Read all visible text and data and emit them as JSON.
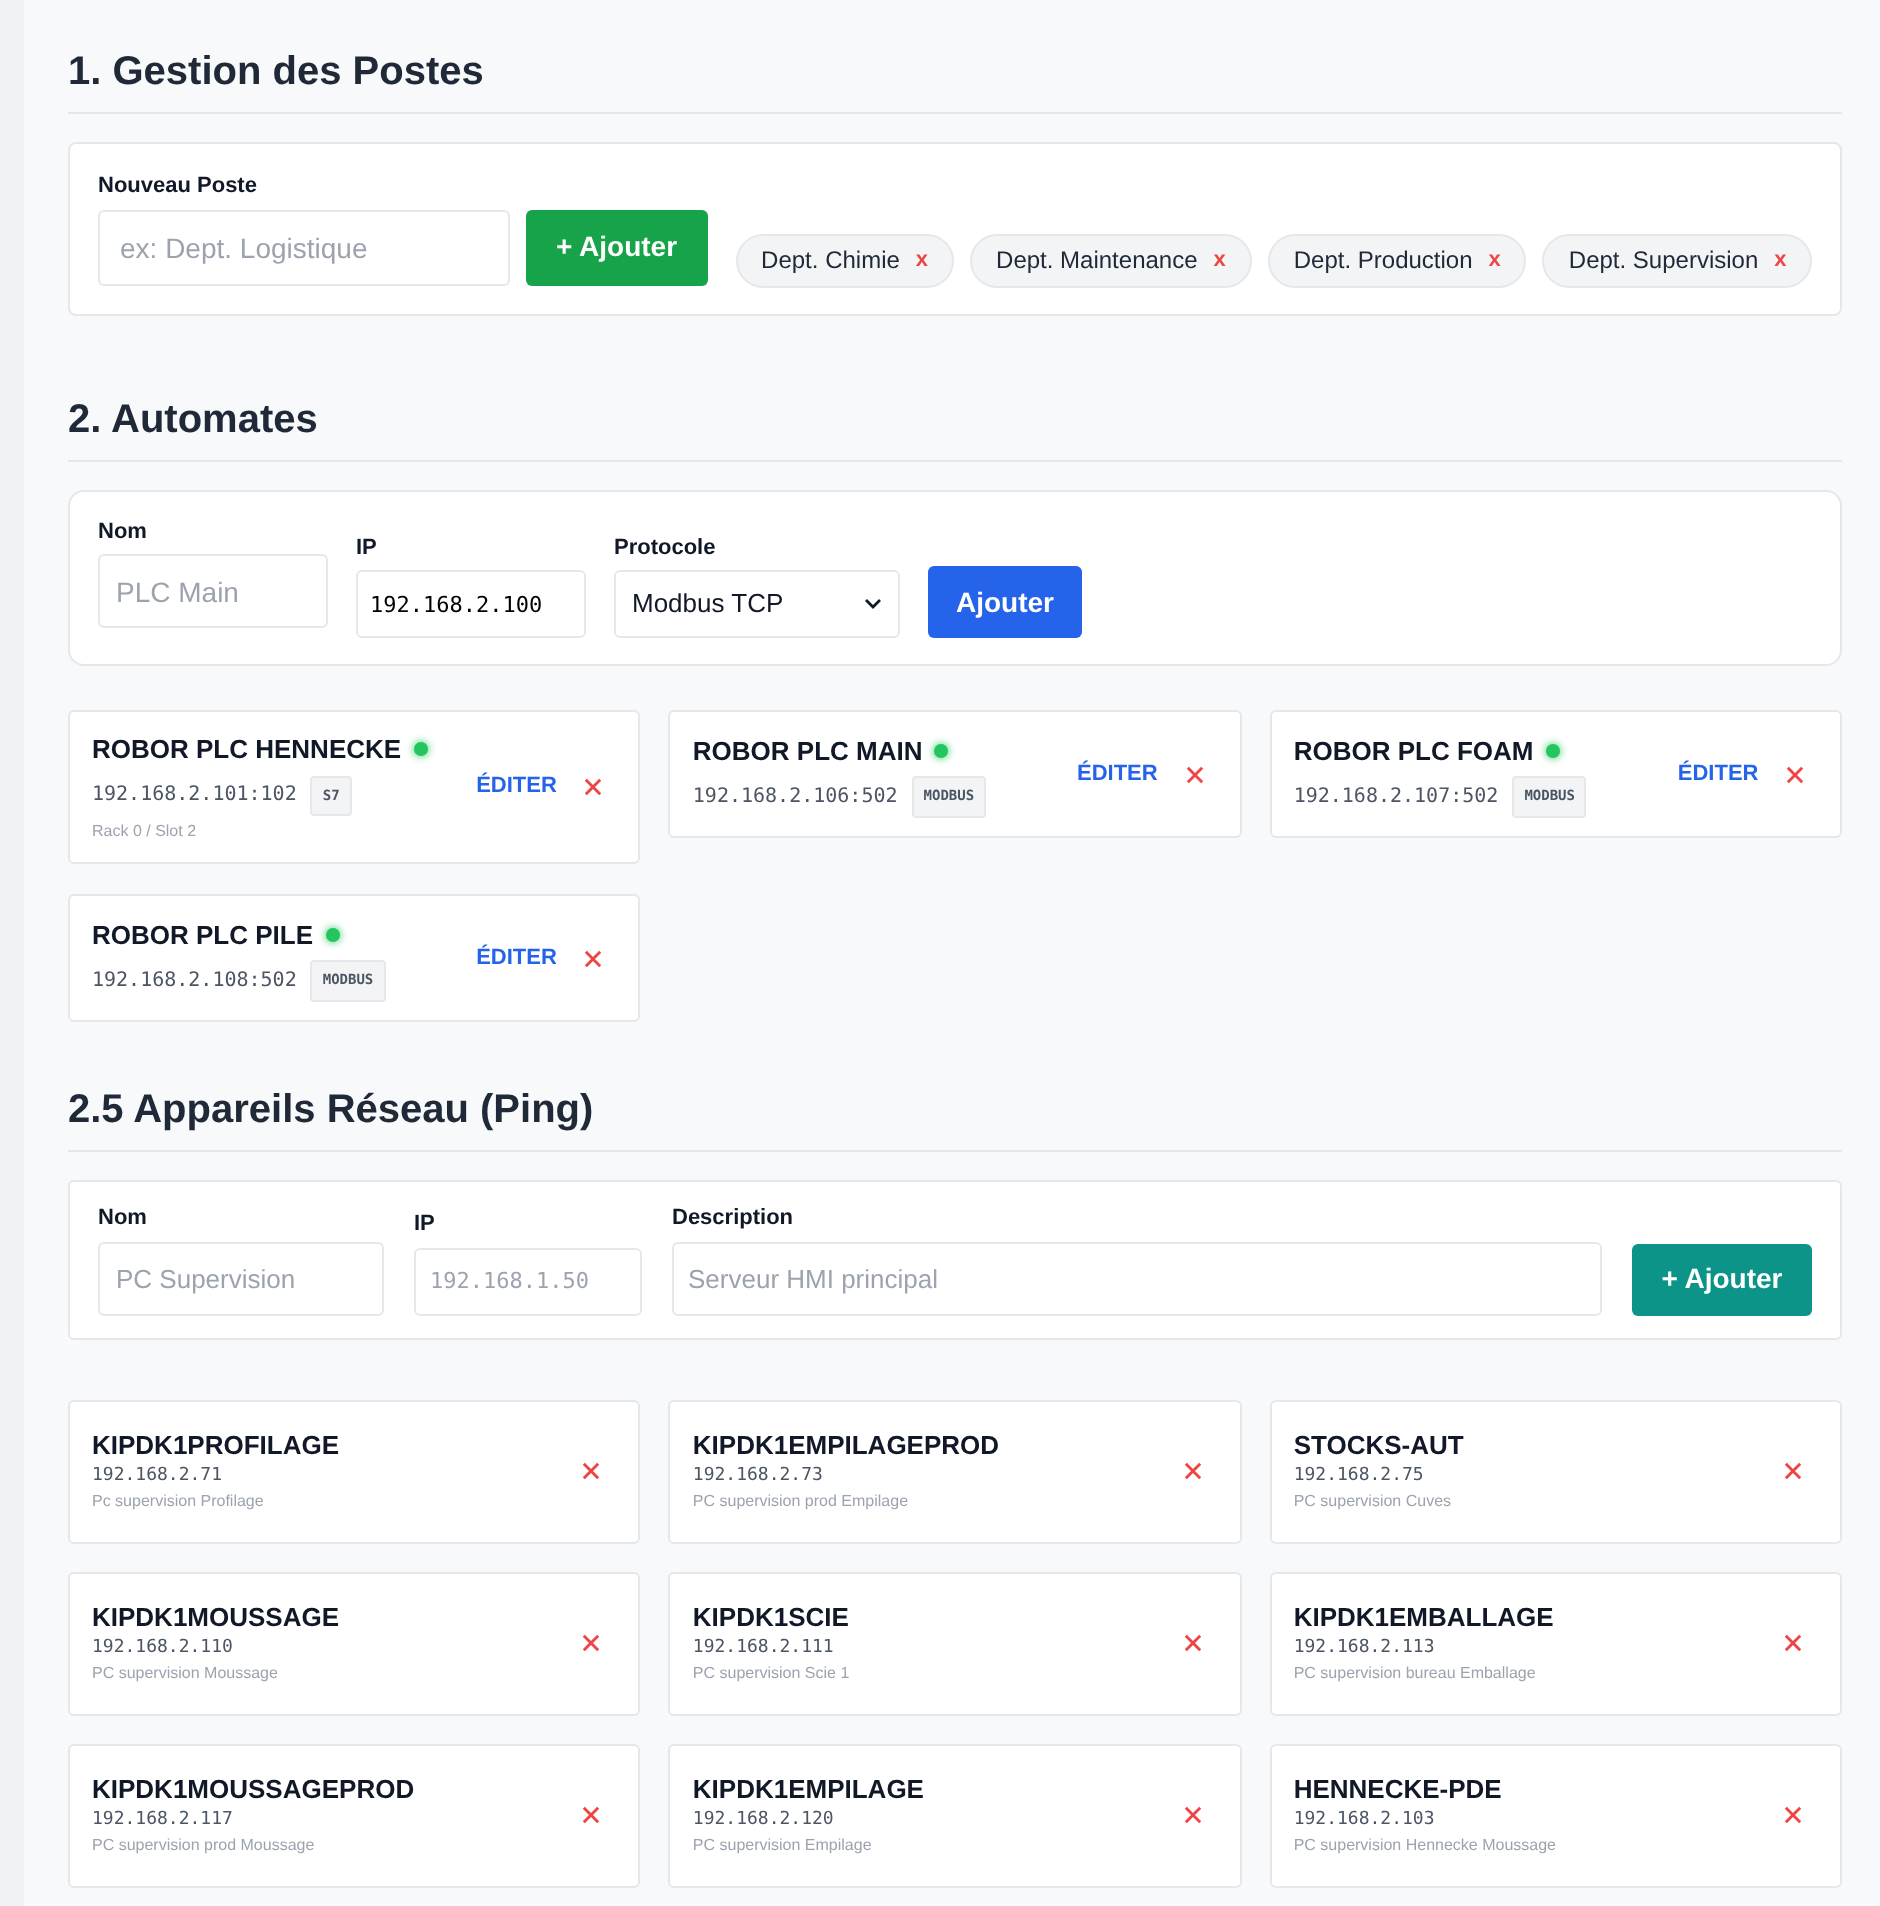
{
  "postes": {
    "title": "1. Gestion des Postes",
    "field_label": "Nouveau Poste",
    "placeholder": "ex: Dept. Logistique",
    "button": "+ Ajouter",
    "tags": [
      {
        "label": "Dept. Chimie",
        "remove": "x"
      },
      {
        "label": "Dept. Maintenance",
        "remove": "x"
      },
      {
        "label": "Dept. Production",
        "remove": "x"
      },
      {
        "label": "Dept. Supervision",
        "remove": "x"
      }
    ]
  },
  "automates": {
    "title": "2. Automates",
    "form": {
      "name_label": "Nom",
      "name_placeholder": "PLC Main",
      "ip_label": "IP",
      "ip_value": "192.168.2.100",
      "protocol_label": "Protocole",
      "protocol_value": "Modbus TCP",
      "button": "Ajouter"
    },
    "plcs": [
      {
        "name": "ROBOR PLC HENNECKE",
        "online": true,
        "address": "192.168.2.101:102",
        "protocol": "S7",
        "detail": "Rack 0 / Slot 2",
        "edit_label": "ÉDITER"
      },
      {
        "name": "ROBOR PLC MAIN",
        "online": true,
        "address": "192.168.2.106:502",
        "protocol": "MODBUS",
        "edit_label": "ÉDITER"
      },
      {
        "name": "ROBOR PLC FOAM",
        "online": true,
        "address": "192.168.2.107:502",
        "protocol": "MODBUS",
        "edit_label": "ÉDITER"
      },
      {
        "name": "ROBOR PLC PILE",
        "online": true,
        "address": "192.168.2.108:502",
        "protocol": "MODBUS",
        "edit_label": "ÉDITER"
      }
    ]
  },
  "appareils": {
    "title": "2.5 Appareils Réseau (Ping)",
    "form": {
      "name_label": "Nom",
      "name_placeholder": "PC Supervision",
      "ip_label": "IP",
      "ip_placeholder": "192.168.1.50",
      "description_label": "Description",
      "description_placeholder": "Serveur HMI principal",
      "button": "+ Ajouter"
    },
    "devices": [
      {
        "name": "KIPDK1PROFILAGE",
        "ip": "192.168.2.71",
        "description": "Pc supervision Profilage"
      },
      {
        "name": "KIPDK1EMPILAGEPROD",
        "ip": "192.168.2.73",
        "description": "PC supervision prod Empilage"
      },
      {
        "name": "STOCKS-AUT",
        "ip": "192.168.2.75",
        "description": "PC supervision Cuves"
      },
      {
        "name": "KIPDK1MOUSSAGE",
        "ip": "192.168.2.110",
        "description": "PC supervision Moussage"
      },
      {
        "name": "KIPDK1SCIE",
        "ip": "192.168.2.111",
        "description": "PC supervision Scie 1"
      },
      {
        "name": "KIPDK1EMBALLAGE",
        "ip": "192.168.2.113",
        "description": "PC supervision bureau Emballage"
      },
      {
        "name": "KIPDK1MOUSSAGEPROD",
        "ip": "192.168.2.117",
        "description": "PC supervision prod Moussage"
      },
      {
        "name": "KIPDK1EMPILAGE",
        "ip": "192.168.2.120",
        "description": "PC supervision Empilage"
      },
      {
        "name": "HENNECKE-PDE",
        "ip": "192.168.2.103",
        "description": "PC supervision Hennecke Moussage"
      }
    ]
  }
}
